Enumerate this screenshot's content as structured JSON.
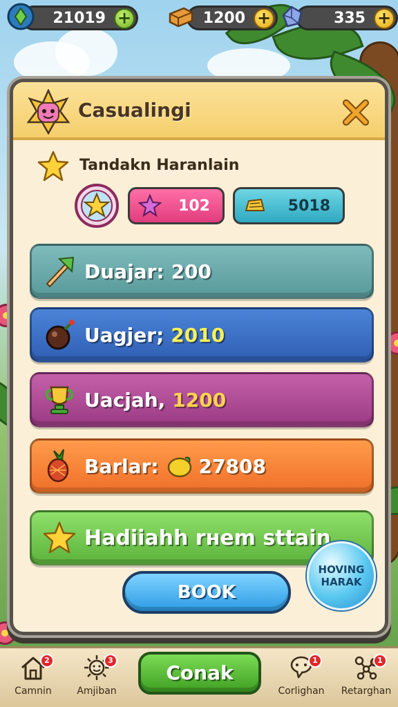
{
  "top_bar": {
    "resources": [
      {
        "icon": "leaf-gem-icon",
        "value": "21019",
        "plus_color": "green"
      },
      {
        "icon": "brick-icon",
        "value": "1200",
        "plus_color": "gold"
      },
      {
        "icon": "crystal-icon",
        "value": "335",
        "plus_color": "gold"
      }
    ]
  },
  "panel": {
    "title": "Casualingi",
    "subtitle": "Tandakn Haranlain",
    "stats": {
      "pink_value": "102",
      "teal_value": "5018"
    },
    "rows": [
      {
        "label": "Duajar:",
        "value": "200",
        "icon": "arrow-cone-icon"
      },
      {
        "label": "Uagjer;",
        "value": "2010",
        "icon": "bomb-icon"
      },
      {
        "label": "Uacjah,",
        "value": "1200",
        "icon": "trophy-icon"
      },
      {
        "label": "Barlar:",
        "value": "27808",
        "icon": "pineapple-icon"
      },
      {
        "label": "Hadiiahh rнem sttain",
        "value": "",
        "icon": "star-icon"
      }
    ],
    "book_label": "BOOK",
    "bubble_lines": [
      "HOVING",
      "HARAK"
    ]
  },
  "bottom_nav": {
    "items": [
      {
        "label": "Camnin",
        "badge": "2",
        "icon": "home-icon"
      },
      {
        "label": "Amjiban",
        "badge": "3",
        "icon": "sun-face-icon"
      },
      {
        "label": "Corlighan",
        "badge": "1",
        "icon": "chat-icon"
      },
      {
        "label": "Retarghan",
        "badge": "1",
        "icon": "network-icon"
      }
    ],
    "center_label": "Conak"
  },
  "colors": {
    "panel_bg": "#fbf0d7",
    "header_bg": "#f5cf6c",
    "row1": "#6aa9aa",
    "row2": "#3e70c6",
    "row3": "#b04c98",
    "row4": "#f7853a",
    "row5": "#72c84d",
    "book_button": "#2c9be4",
    "nav_button": "#3e9f22"
  }
}
